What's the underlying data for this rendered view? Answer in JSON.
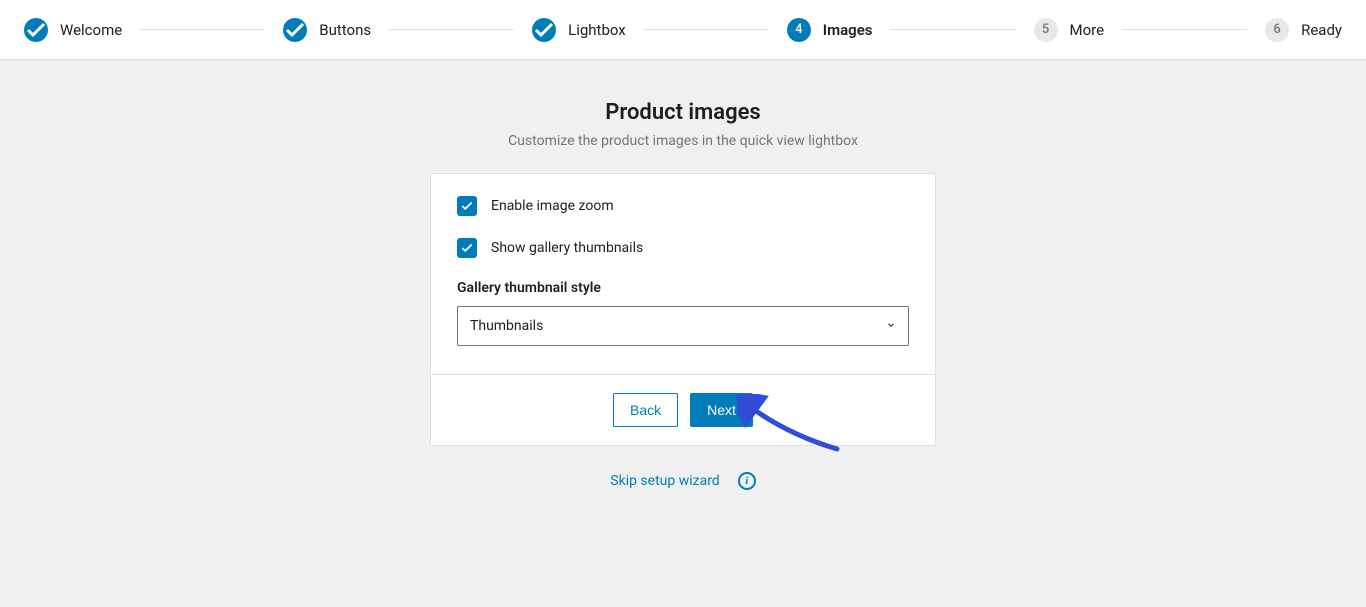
{
  "stepper": {
    "steps": [
      {
        "label": "Welcome",
        "state": "done",
        "indicator": "check"
      },
      {
        "label": "Buttons",
        "state": "done",
        "indicator": "check"
      },
      {
        "label": "Lightbox",
        "state": "done",
        "indicator": "check"
      },
      {
        "label": "Images",
        "state": "current",
        "indicator": "4"
      },
      {
        "label": "More",
        "state": "pending",
        "indicator": "5"
      },
      {
        "label": "Ready",
        "state": "pending",
        "indicator": "6"
      }
    ]
  },
  "page": {
    "title": "Product images",
    "subtitle": "Customize the product images in the quick view lightbox"
  },
  "form": {
    "enable_zoom_label": "Enable image zoom",
    "enable_zoom_checked": true,
    "show_thumbnails_label": "Show gallery thumbnails",
    "show_thumbnails_checked": true,
    "gallery_style_label": "Gallery thumbnail style",
    "gallery_style_value": "Thumbnails"
  },
  "buttons": {
    "back": "Back",
    "next": "Next"
  },
  "footer": {
    "skip": "Skip setup wizard"
  }
}
